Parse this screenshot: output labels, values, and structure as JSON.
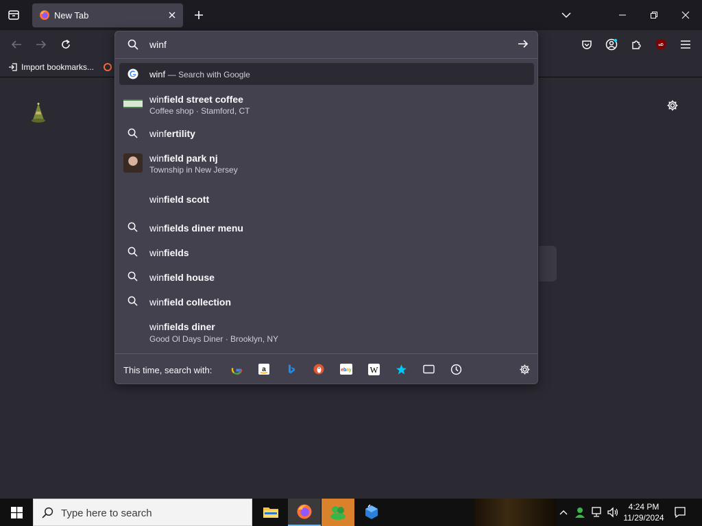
{
  "tab": {
    "title": "New Tab"
  },
  "bookmarks": {
    "import_label": "Import bookmarks..."
  },
  "urlbar": {
    "query": "winf"
  },
  "suggestions": [
    {
      "prefix": "winf",
      "bold": "",
      "engine_note": "— Search with Google",
      "secondary": ""
    },
    {
      "prefix": "win",
      "bold": "field street coffee",
      "secondary": "Coffee shop · Stamford, CT"
    },
    {
      "prefix": "winf",
      "bold": "ertility",
      "secondary": ""
    },
    {
      "prefix": "win",
      "bold": "field park nj",
      "secondary": "Township in New Jersey"
    },
    {
      "prefix": "win",
      "bold": "field scott",
      "secondary": ""
    },
    {
      "prefix": "win",
      "bold": "fields diner menu",
      "secondary": ""
    },
    {
      "prefix": "win",
      "bold": "fields",
      "secondary": ""
    },
    {
      "prefix": "win",
      "bold": "field house",
      "secondary": ""
    },
    {
      "prefix": "win",
      "bold": "field collection",
      "secondary": ""
    },
    {
      "prefix": "win",
      "bold": "fields diner",
      "secondary": "Good Ol Days Diner · Brooklyn, NY"
    }
  ],
  "oneoff": {
    "label": "This time, search with:",
    "engines": [
      "google-icon",
      "amazon-icon",
      "bing-icon",
      "duckduckgo-icon",
      "ebay-icon",
      "wikipedia-icon",
      "bookmarks-star-icon",
      "tabs-icon",
      "history-icon"
    ]
  },
  "taskbar": {
    "search_placeholder": "Type here to search",
    "time": "4:24 PM",
    "date": "11/29/2024"
  },
  "colors": {
    "toolbar": "#2b2a33",
    "dropdown": "#42414d",
    "tabstrip": "#1c1b22",
    "accent_pocket": "#fbfbfe",
    "ublock": "#800000"
  }
}
